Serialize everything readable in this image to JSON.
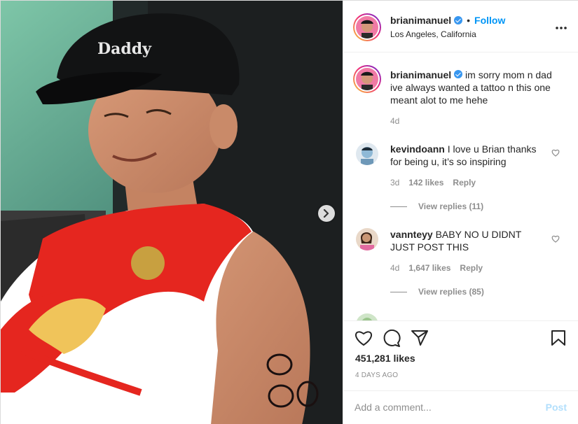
{
  "post": {
    "username": "brianimanuel",
    "verified": true,
    "follow_label": "Follow",
    "bullet": "•",
    "location": "Los Angeles, California",
    "more_icon": "more-horizontal-icon",
    "hat_text": "Daddy"
  },
  "caption": {
    "username": "brianimanuel",
    "text": "im sorry mom n dad ive always wanted a tattoo n this one meant alot to me hehe",
    "time": "4d"
  },
  "comments": [
    {
      "username": "kevindoann",
      "text": "I love u Brian thanks for being u, it’s so inspiring",
      "time": "3d",
      "likes": "142 likes",
      "reply_label": "Reply",
      "view_replies": "View replies (11)"
    },
    {
      "username": "vannteyy",
      "text": "BABY NO U DIDNT JUST POST THIS",
      "time": "4d",
      "likes": "1,647 likes",
      "reply_label": "Reply",
      "view_replies": "View replies (85)"
    }
  ],
  "actions": {
    "icons": [
      "heart-icon",
      "comment-icon",
      "share-icon",
      "bookmark-icon"
    ],
    "likes": "451,281 likes",
    "date": "4 DAYS AGO"
  },
  "composer": {
    "placeholder": "Add a comment...",
    "post_label": "Post"
  },
  "carousel": {
    "total": 5,
    "active_index": 0
  },
  "colors": {
    "accent": "#0095f6",
    "muted": "#8e8e8e",
    "verified": "#3897f0",
    "post_disabled": "#b2dffc"
  }
}
